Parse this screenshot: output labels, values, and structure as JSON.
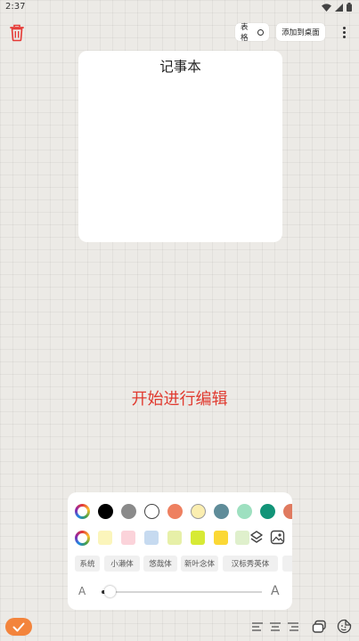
{
  "status_bar": {
    "time": "2:37"
  },
  "toolbar": {
    "table_label": "表格",
    "add_desktop_label": "添加到桌面"
  },
  "note": {
    "title": "记事本"
  },
  "hint": "开始进行编辑",
  "palette": {
    "text_colors": [
      "#000000",
      "#8a8a8a",
      "#ffffff",
      "#ee8060",
      "#fbeeb0",
      "#5f8c99",
      "#9ee0c0",
      "#129478",
      "#e07a5f"
    ],
    "bg_colors": [
      "#fbf5bb",
      "#fbd3da",
      "#c6daf0",
      "#e7f0a8",
      "#d7ea35",
      "#fbd835",
      "#dff0cc"
    ]
  },
  "fonts": [
    "系统",
    "小濑体",
    "悠哉体",
    "新叶念体",
    "汉标秀英体"
  ],
  "font_size": {
    "small_label": "A",
    "large_label": "A",
    "value_fraction": 0.05
  }
}
